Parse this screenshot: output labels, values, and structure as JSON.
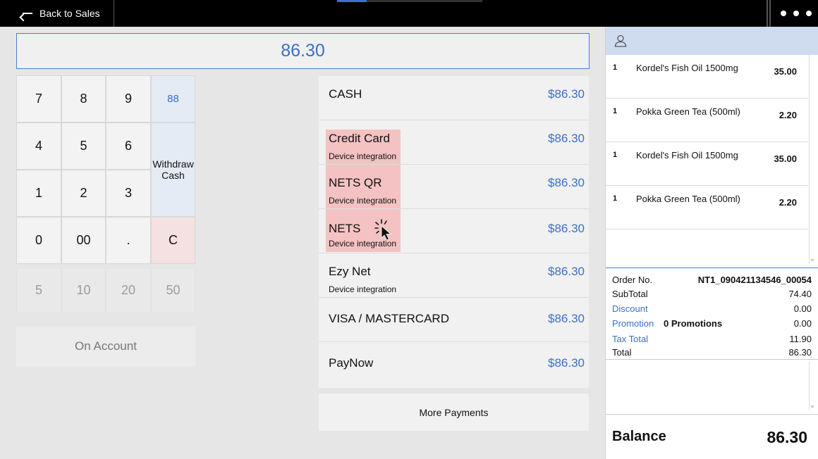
{
  "topbar": {
    "back_label": "Back to Sales"
  },
  "amount_display": "86.30",
  "keypad": {
    "keys": [
      "7",
      "8",
      "9",
      "88",
      "4",
      "5",
      "6",
      "1",
      "2",
      "3",
      "0",
      "00",
      ".",
      "C"
    ],
    "withdraw_label": "Withdraw Cash",
    "quick_amounts": [
      "5",
      "10",
      "20",
      "50"
    ]
  },
  "on_account_label": "On Account",
  "payments": [
    {
      "name": "CASH",
      "sub": "",
      "amount": "$86.30"
    },
    {
      "name": "Credit Card",
      "sub": "Device integration",
      "amount": "$86.30"
    },
    {
      "name": "NETS QR",
      "sub": "Device integration",
      "amount": "$86.30"
    },
    {
      "name": "NETS",
      "sub": "Device integration",
      "amount": "$86.30"
    },
    {
      "name": "Ezy Net",
      "sub": "Device integration",
      "amount": "$86.30"
    },
    {
      "name": "VISA / MASTERCARD",
      "sub": "",
      "amount": "$86.30"
    },
    {
      "name": "PayNow",
      "sub": "",
      "amount": "$86.30"
    }
  ],
  "more_payments_label": "More Payments",
  "order_items": [
    {
      "qty": "1",
      "name": "Kordel's Fish Oil 1500mg",
      "price": "35.00"
    },
    {
      "qty": "1",
      "name": "Pokka Green Tea (500ml)",
      "price": "2.20"
    },
    {
      "qty": "1",
      "name": "Kordel's Fish Oil 1500mg",
      "price": "35.00"
    },
    {
      "qty": "1",
      "name": "Pokka Green Tea (500ml)",
      "price": "2.20"
    }
  ],
  "summary": {
    "order_no_label": "Order No.",
    "order_no": "NT1_090421134546_00054",
    "subtotal_label": "SubTotal",
    "subtotal": "74.40",
    "discount_label": "Discount",
    "discount": "0.00",
    "promotion_label": "Promotion",
    "promotion_count": "0 Promotions",
    "promotion": "0.00",
    "tax_label": "Tax Total",
    "tax": "11.90",
    "total_label": "Total",
    "total": "86.30"
  },
  "balance": {
    "label": "Balance",
    "value": "86.30"
  },
  "colors": {
    "accent": "#3b6fc8",
    "highlight": "#f4c2c2",
    "customer_bar": "#cfdcf0"
  }
}
